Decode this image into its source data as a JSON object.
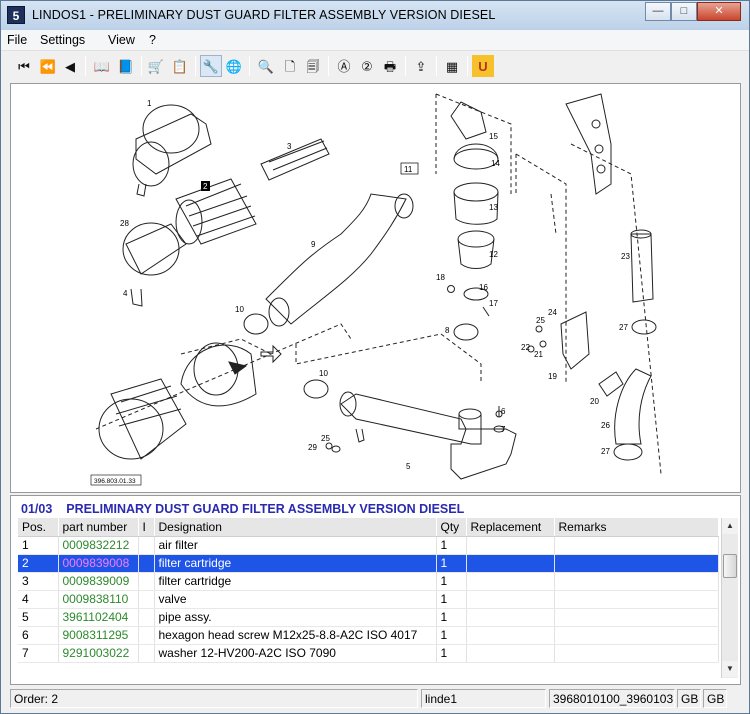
{
  "window": {
    "app_icon": "5",
    "title": "LINDOS1 - PRELIMINARY DUST GUARD FILTER ASSEMBLY VERSION DIESEL",
    "minimize_glyph": "—",
    "maximize_glyph": "□",
    "close_glyph": "✕"
  },
  "menu": {
    "items": [
      "File",
      "Settings",
      "View",
      "?"
    ]
  },
  "toolbar": {
    "buttons": [
      {
        "name": "first-icon",
        "glyph": "⏮"
      },
      {
        "name": "previous-page-icon",
        "glyph": "⏪"
      },
      {
        "name": "previous-icon",
        "glyph": "◀"
      },
      {
        "name": "book-back-icon",
        "glyph": "📖"
      },
      {
        "name": "book-forward-icon",
        "glyph": "📘"
      },
      {
        "name": "cart-icon",
        "glyph": "🛒"
      },
      {
        "name": "order-list-icon",
        "glyph": "📋"
      },
      {
        "name": "tools-icon",
        "glyph": "🔧"
      },
      {
        "name": "globe-icon",
        "glyph": "🌐"
      },
      {
        "name": "zoom-icon",
        "glyph": "🔍"
      },
      {
        "name": "page-icon",
        "glyph": "🗋"
      },
      {
        "name": "page-alt-icon",
        "glyph": "🗐"
      },
      {
        "name": "search-a-icon",
        "glyph": "Ⓐ"
      },
      {
        "name": "search-2-icon",
        "glyph": "②"
      },
      {
        "name": "print-icon",
        "glyph": "🖶"
      },
      {
        "name": "export-icon",
        "glyph": "⇪"
      },
      {
        "name": "grid-icon",
        "glyph": "▦"
      },
      {
        "name": "u-icon",
        "glyph": "U"
      }
    ]
  },
  "drawing": {
    "ref_label": "396.803.01.33",
    "callouts": [
      "1",
      "2",
      "3",
      "28",
      "4",
      "9",
      "10",
      "11",
      "15",
      "14",
      "13",
      "12",
      "18",
      "16",
      "17",
      "8",
      "23",
      "27",
      "24",
      "25",
      "22",
      "21",
      "19",
      "20",
      "26",
      "10",
      "6",
      "7",
      "29",
      "25",
      "5",
      "27"
    ]
  },
  "parts": {
    "section_code": "01/03",
    "section_title": "PRELIMINARY DUST GUARD FILTER ASSEMBLY VERSION DIESEL",
    "columns": [
      "Pos.",
      "part number",
      "I",
      "Designation",
      "Qty",
      "Replacement",
      "Remarks"
    ],
    "rows": [
      {
        "pos": "1",
        "part": "0009832212",
        "i": "",
        "designation": "air filter",
        "qty": "1",
        "replacement": "",
        "remarks": ""
      },
      {
        "pos": "2",
        "part": "0009839008",
        "i": "",
        "designation": "filter cartridge",
        "qty": "1",
        "replacement": "",
        "remarks": "",
        "selected": true
      },
      {
        "pos": "3",
        "part": "0009839009",
        "i": "",
        "designation": "filter cartridge",
        "qty": "1",
        "replacement": "",
        "remarks": ""
      },
      {
        "pos": "4",
        "part": "0009838110",
        "i": "",
        "designation": "valve",
        "qty": "1",
        "replacement": "",
        "remarks": ""
      },
      {
        "pos": "5",
        "part": "3961102404",
        "i": "",
        "designation": "pipe assy.",
        "qty": "1",
        "replacement": "",
        "remarks": ""
      },
      {
        "pos": "6",
        "part": "9008311295",
        "i": "",
        "designation": "hexagon head screw M12x25-8.8-A2C  ISO 4017",
        "qty": "1",
        "replacement": "",
        "remarks": ""
      },
      {
        "pos": "7",
        "part": "9291003022",
        "i": "",
        "designation": "washer 12-HV200-A2C  ISO 7090",
        "qty": "1",
        "replacement": "",
        "remarks": ""
      }
    ]
  },
  "status": {
    "order": "Order: 2",
    "user": "linde1",
    "codes": "3968010100_3960103",
    "lang1": "GB",
    "lang2": "GB"
  },
  "colors": {
    "selection": "#1f55e6",
    "part_number": "#2c8a2c",
    "heading": "#2a2ab0"
  }
}
